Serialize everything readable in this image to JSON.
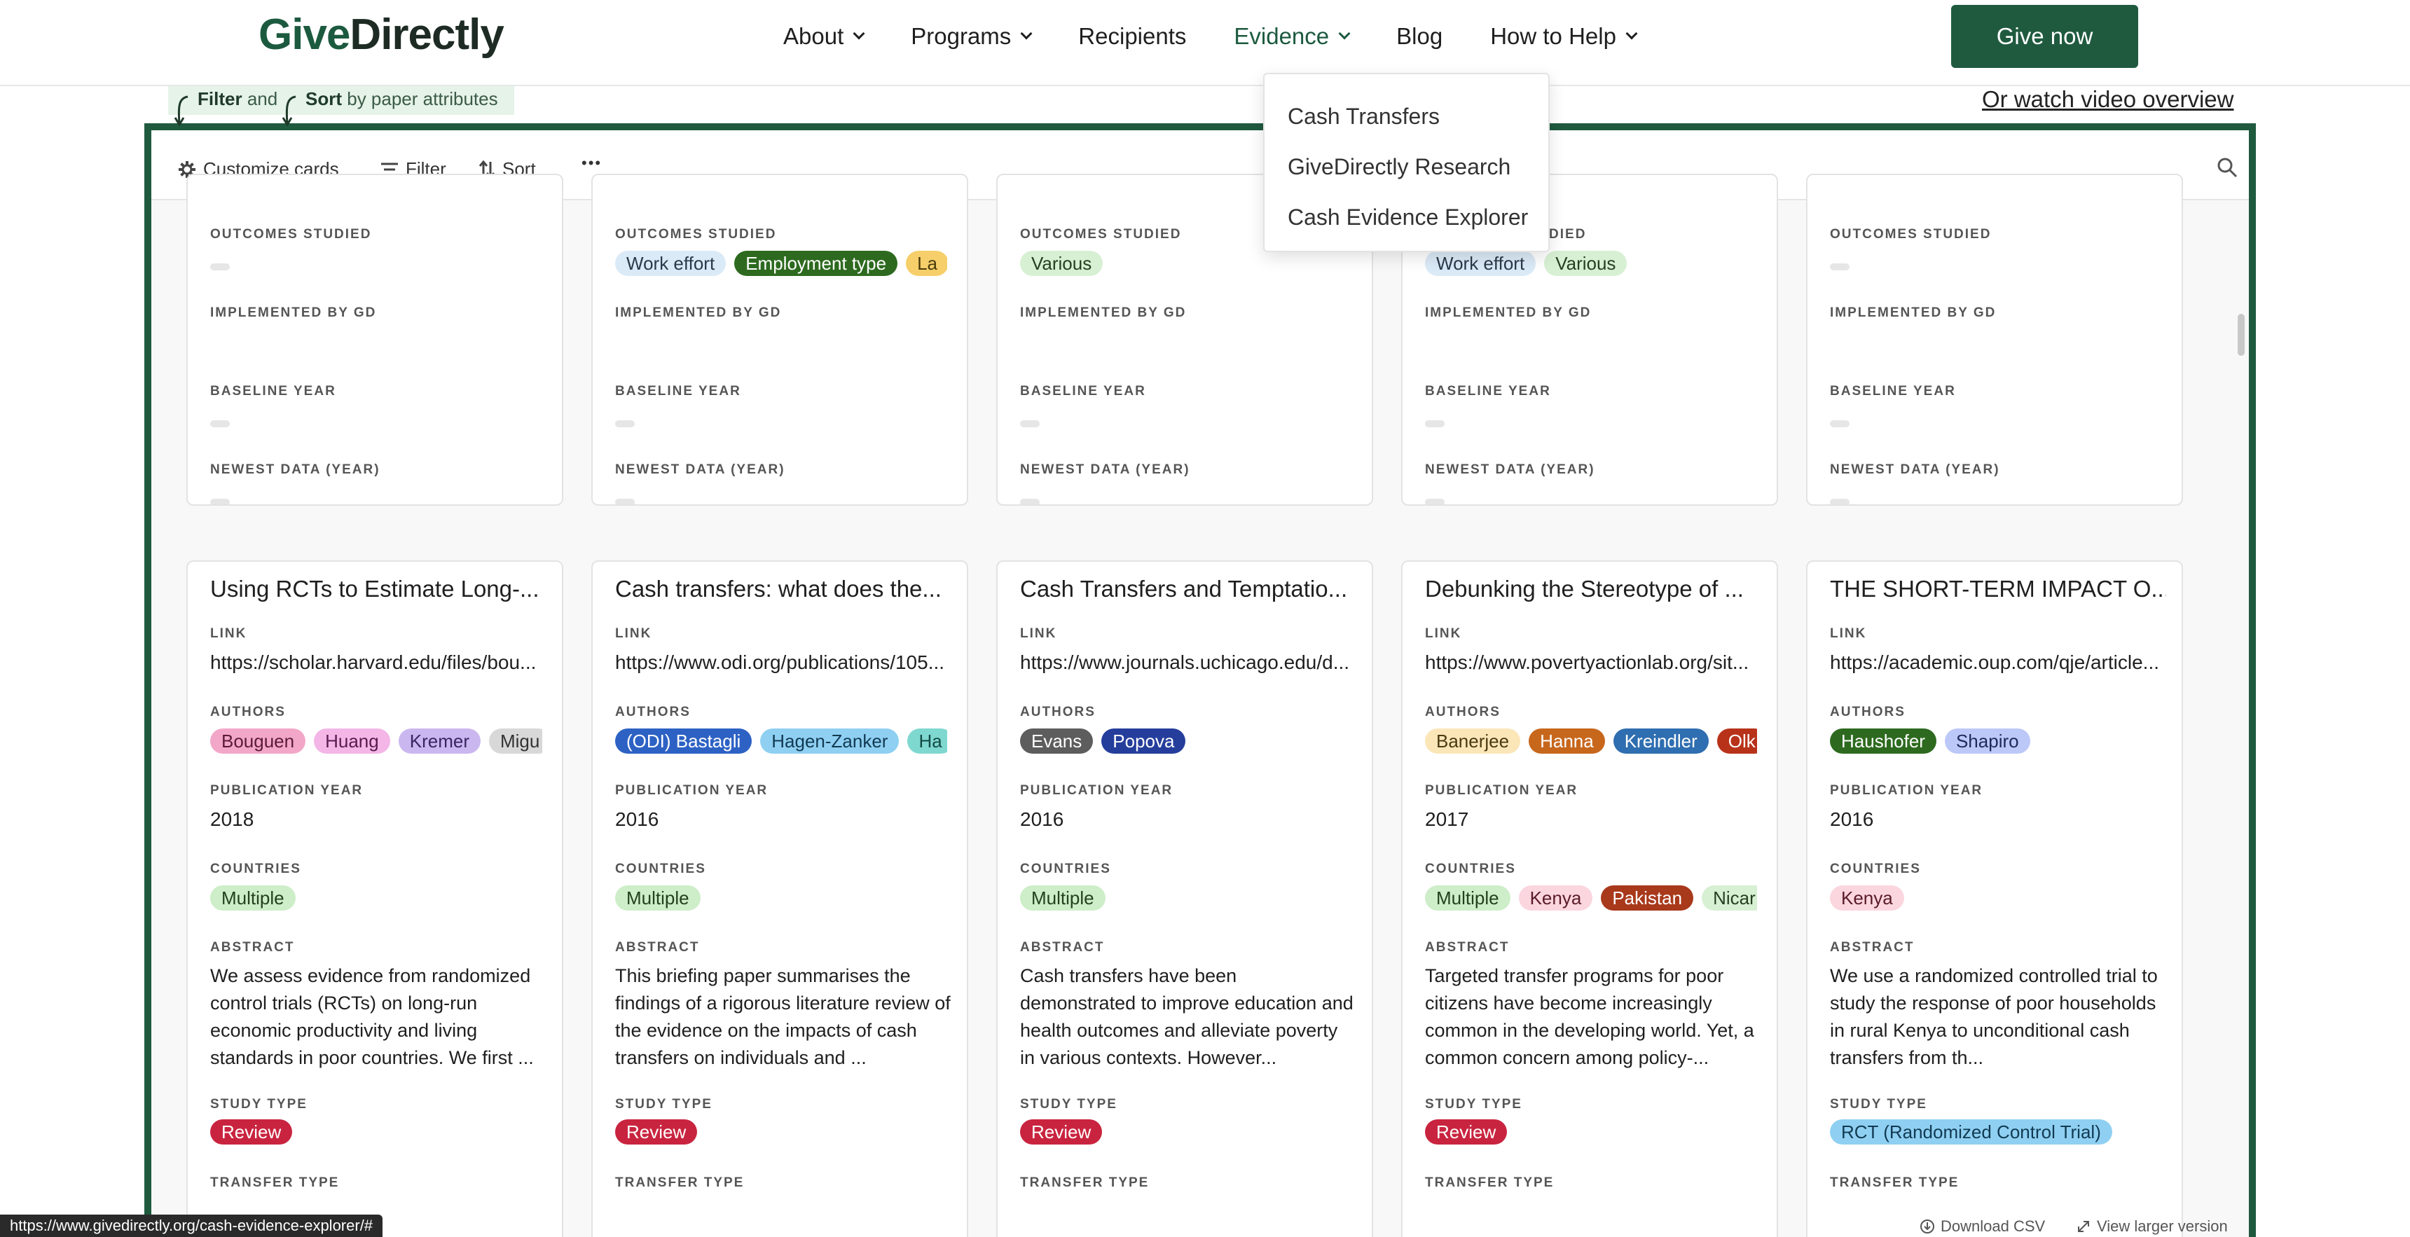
{
  "header": {
    "logo_part1": "Give",
    "logo_part2": "Directly",
    "nav": [
      {
        "label": "About",
        "dropdown": true
      },
      {
        "label": "Programs",
        "dropdown": true
      },
      {
        "label": "Recipients",
        "dropdown": false
      },
      {
        "label": "Evidence",
        "dropdown": true,
        "active": true
      },
      {
        "label": "Blog",
        "dropdown": false
      },
      {
        "label": "How to Help",
        "dropdown": true
      }
    ],
    "cta": "Give now"
  },
  "evidence_menu": [
    "Cash Transfers",
    "GiveDirectly Research",
    "Cash Evidence Explorer"
  ],
  "hint": {
    "filter": "Filter",
    "and": "and",
    "sort": "Sort",
    "rest": "by paper attributes"
  },
  "video_link": "Or watch video overview",
  "toolbar": {
    "customize": "Customize cards",
    "filter": "Filter",
    "sort": "Sort",
    "more": "•••"
  },
  "labels": {
    "outcomes": "OUTCOMES STUDIED",
    "implemented": "IMPLEMENTED BY GD",
    "baseline": "BASELINE YEAR",
    "newest": "NEWEST DATA (YEAR)",
    "link": "LINK",
    "authors": "AUTHORS",
    "pubyear": "PUBLICATION YEAR",
    "countries": "COUNTRIES",
    "abstract": "ABSTRACT",
    "studytype": "STUDY TYPE",
    "transfertype": "TRANSFER TYPE"
  },
  "top_cards": [
    {
      "outcomes": []
    },
    {
      "outcomes": [
        {
          "t": "Work effort",
          "c": "#dbeaf7",
          "f": "#2b3a4a"
        },
        {
          "t": "Employment type",
          "c": "#2d6a1f",
          "f": "#ffffff"
        },
        {
          "t": "La",
          "c": "#f6cf6a",
          "f": "#4a3a0a"
        }
      ]
    },
    {
      "outcomes": [
        {
          "t": "Various",
          "c": "#d7f0d3",
          "f": "#24401f"
        }
      ]
    },
    {
      "outcomes": [
        {
          "t": "Work effort",
          "c": "#dbeaf7",
          "f": "#2b3a4a"
        },
        {
          "t": "Various",
          "c": "#d7f0d3",
          "f": "#24401f"
        }
      ]
    },
    {
      "outcomes": []
    }
  ],
  "cards": [
    {
      "title": "Using RCTs to Estimate Long-...",
      "link": "https://scholar.harvard.edu/files/bou...",
      "authors": [
        {
          "t": "Bouguen",
          "c": "#f3a7c8",
          "f": "#5a1b38"
        },
        {
          "t": "Huang",
          "c": "#f3b6e6",
          "f": "#5a1b50"
        },
        {
          "t": "Kremer",
          "c": "#cbb7f0",
          "f": "#3a2560"
        },
        {
          "t": "Migu",
          "c": "#d8d8d8",
          "f": "#333333"
        }
      ],
      "year": "2018",
      "countries": [
        {
          "t": "Multiple",
          "c": "#cdeec8",
          "f": "#24401f"
        }
      ],
      "abstract": "We assess evidence from randomized control trials (RCTs) on long-run economic productivity and living standards in poor countries. We first ...",
      "study": [
        {
          "t": "Review",
          "c": "#c9243f",
          "f": "#ffffff"
        }
      ]
    },
    {
      "title": "Cash transfers: what does the...",
      "link": "https://www.odi.org/publications/105...",
      "authors": [
        {
          "t": "(ODI) Bastagli",
          "c": "#2d62c4",
          "f": "#ffffff"
        },
        {
          "t": "Hagen-Zanker",
          "c": "#8fd0f2",
          "f": "#123a52"
        },
        {
          "t": "Ha",
          "c": "#7fd8d0",
          "f": "#124a45"
        }
      ],
      "year": "2016",
      "countries": [
        {
          "t": "Multiple",
          "c": "#cdeec8",
          "f": "#24401f"
        }
      ],
      "abstract": "This briefing paper summarises the findings of a rigorous literature review of the evidence on the impacts of cash transfers on individuals and ...",
      "study": [
        {
          "t": "Review",
          "c": "#c9243f",
          "f": "#ffffff"
        }
      ]
    },
    {
      "title": "Cash Transfers and Temptatio...",
      "link": "https://www.journals.uchicago.edu/d...",
      "authors": [
        {
          "t": "Evans",
          "c": "#5d5d5d",
          "f": "#ffffff"
        },
        {
          "t": "Popova",
          "c": "#253e9c",
          "f": "#ffffff"
        }
      ],
      "year": "2016",
      "countries": [
        {
          "t": "Multiple",
          "c": "#cdeec8",
          "f": "#24401f"
        }
      ],
      "abstract": "Cash transfers have been demonstrated to improve education and health outcomes and alleviate poverty in various contexts. However...",
      "study": [
        {
          "t": "Review",
          "c": "#c9243f",
          "f": "#ffffff"
        }
      ]
    },
    {
      "title": "Debunking the Stereotype of ...",
      "link": "https://www.povertyactionlab.org/sit...",
      "authors": [
        {
          "t": "Banerjee",
          "c": "#fbe6b8",
          "f": "#4a3a10"
        },
        {
          "t": "Hanna",
          "c": "#c7671c",
          "f": "#ffffff"
        },
        {
          "t": "Kreindler",
          "c": "#2f6eb0",
          "f": "#ffffff"
        },
        {
          "t": "Olk",
          "c": "#b8321a",
          "f": "#ffffff"
        }
      ],
      "year": "2017",
      "countries": [
        {
          "t": "Multiple",
          "c": "#cdeec8",
          "f": "#24401f"
        },
        {
          "t": "Kenya",
          "c": "#fbd6de",
          "f": "#5a1b28"
        },
        {
          "t": "Pakistan",
          "c": "#a8391b",
          "f": "#ffffff"
        },
        {
          "t": "Nicar",
          "c": "#d7f0d3",
          "f": "#24401f"
        }
      ],
      "abstract": "Targeted transfer programs for poor citizens have become increasingly common in the developing world. Yet, a common concern among policy-...",
      "study": [
        {
          "t": "Review",
          "c": "#c9243f",
          "f": "#ffffff"
        }
      ]
    },
    {
      "title": "THE SHORT-TERM IMPACT O...",
      "link": "https://academic.oup.com/qje/article...",
      "authors": [
        {
          "t": "Haushofer",
          "c": "#2d6a1f",
          "f": "#ffffff"
        },
        {
          "t": "Shapiro",
          "c": "#bcc8f8",
          "f": "#1f2a5a"
        }
      ],
      "year": "2016",
      "countries": [
        {
          "t": "Kenya",
          "c": "#fbd6de",
          "f": "#5a1b28"
        }
      ],
      "abstract": "We use a randomized controlled trial to study the response of poor households in rural Kenya to unconditional cash transfers from th...",
      "study": [
        {
          "t": "RCT (Randomized Control Trial)",
          "c": "#8fd0f2",
          "f": "#123a52"
        }
      ]
    }
  ],
  "footer": {
    "download": "Download CSV",
    "larger": "View larger version"
  },
  "status_url": "https://www.givedirectly.org/cash-evidence-explorer/#"
}
